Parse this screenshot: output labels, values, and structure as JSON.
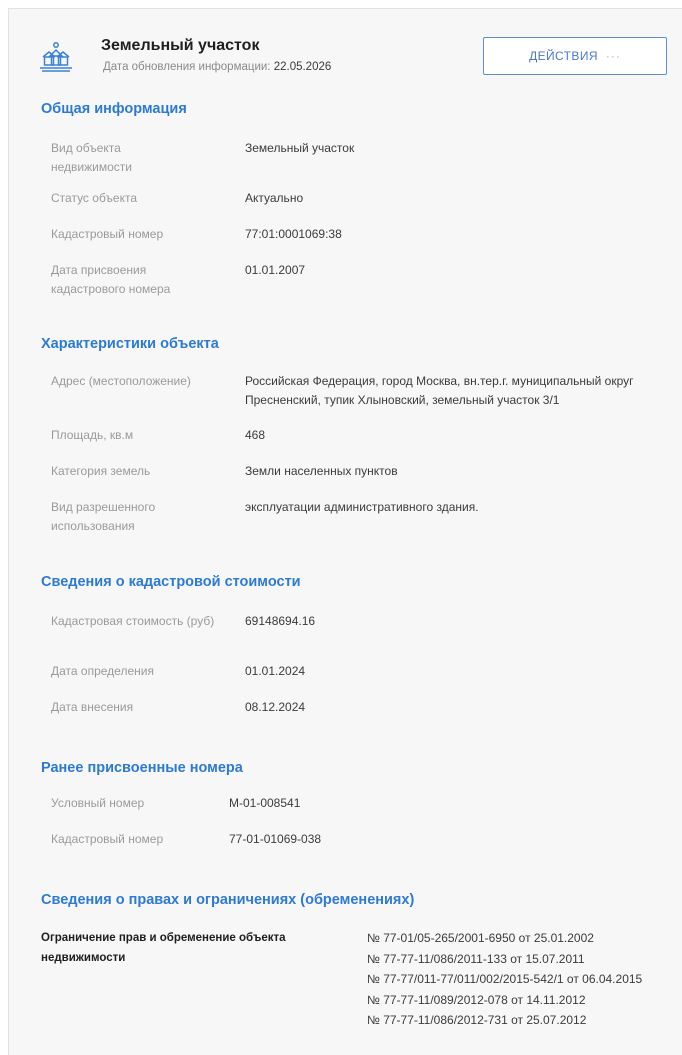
{
  "header": {
    "icon": "land-plot-house-icon",
    "title": "Земельный участок",
    "update_label": "Дата обновления информации:",
    "update_date": "22.05.2026",
    "actions_label": "ДЕЙСТВИЯ",
    "actions_icon": "more-dots-icon"
  },
  "general": {
    "title": "Общая информация",
    "rows": [
      {
        "label": "Вид объекта недвижимости",
        "value": "Земельный участок"
      },
      {
        "label": "Статус объекта",
        "value": "Актуально"
      },
      {
        "label": "Кадастровый номер",
        "value": "77:01:0001069:38"
      },
      {
        "label": "Дата присвоения кадастрового номера",
        "value": "01.01.2007"
      }
    ]
  },
  "characteristics": {
    "title": "Характеристики объекта",
    "rows": [
      {
        "label": "Адрес (местоположение)",
        "value": "Российская Федерация, город Москва, вн.тер.г. муниципальный округ Пресненский, тупик Хлыновский, земельный участок 3/1"
      },
      {
        "label": "Площадь, кв.м",
        "value": "468"
      },
      {
        "label": "Категория земель",
        "value": "Земли населенных пунктов"
      },
      {
        "label": "Вид разрешенного использования",
        "value": "эксплуатации административного здания."
      }
    ]
  },
  "cadastral_value": {
    "title": "Сведения о кадастровой стоимости",
    "rows": [
      {
        "label": "Кадастровая стоимость (руб)",
        "value": "69148694.16"
      },
      {
        "label": "Дата определения",
        "value": "01.01.2024"
      },
      {
        "label": "Дата внесения",
        "value": "08.12.2024"
      }
    ]
  },
  "previous_numbers": {
    "title": "Ранее присвоенные номера",
    "rows": [
      {
        "label": "Условный номер",
        "value": "М-01-008541"
      },
      {
        "label": "Кадастровый номер",
        "value": "77-01-01069-038"
      }
    ]
  },
  "rights": {
    "title": "Сведения о правах и ограничениях (обременениях)",
    "label": "Ограничение прав и обременение объекта недвижимости",
    "items": [
      "№ 77-01/05-265/2001-6950 от 25.01.2002",
      "№ 77-77-11/086/2011-133 от 15.07.2011",
      "№ 77-77/011-77/011/002/2015-542/1 от 06.04.2015",
      "№ 77-77-11/089/2012-078 от 14.11.2012",
      "№ 77-77-11/086/2012-731 от 25.07.2012"
    ]
  },
  "colors": {
    "section_title": "#2d7ad6",
    "button_border": "#5e8fd1",
    "label_gray": "#9a9a9a",
    "background": "#f7f7f7"
  }
}
